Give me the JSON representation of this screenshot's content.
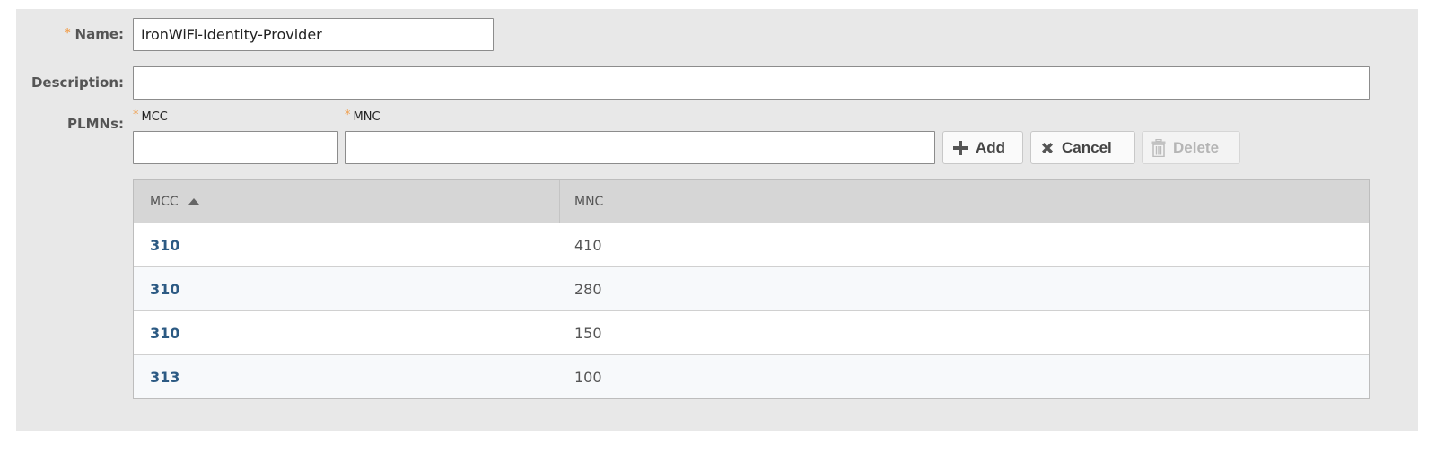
{
  "form": {
    "name_label": "Name:",
    "name_value": "IronWiFi-Identity-Provider",
    "description_label": "Description:",
    "description_value": "",
    "plmns_label": "PLMNs:",
    "mcc_label": "MCC",
    "mnc_label": "MNC",
    "mcc_value": "",
    "mnc_value": "",
    "required_mark": "*"
  },
  "buttons": {
    "add": "Add",
    "cancel": "Cancel",
    "delete": "Delete"
  },
  "table": {
    "columns": [
      "MCC",
      "MNC"
    ],
    "sort": "ascending",
    "rows": [
      {
        "mcc": "310",
        "mnc": "410"
      },
      {
        "mcc": "310",
        "mnc": "280"
      },
      {
        "mcc": "310",
        "mnc": "150"
      },
      {
        "mcc": "313",
        "mnc": "100"
      }
    ]
  },
  "colors": {
    "required": "#f0a050",
    "link": "#2c5a83",
    "panel_bg": "#e8e8e8",
    "header_bg": "#d6d6d6"
  }
}
